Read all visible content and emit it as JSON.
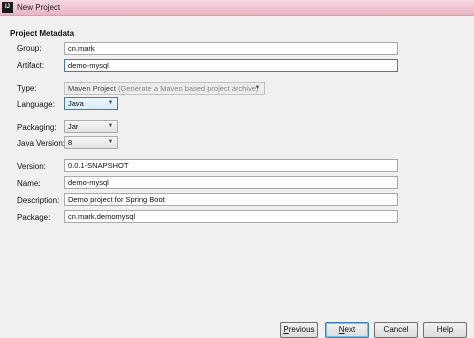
{
  "window": {
    "icon_text": "IJ",
    "title": "New Project"
  },
  "section_title": "Project Metadata",
  "fields": {
    "group": {
      "label": "Group:",
      "value": "cn.mark"
    },
    "artifact": {
      "label": "Artifact:",
      "value": "demo-mysql"
    },
    "type": {
      "label": "Type:",
      "value": "Maven Project",
      "hint": "(Generate a Maven based project archive)"
    },
    "language": {
      "label": "Language:",
      "value": "Java"
    },
    "packaging": {
      "label": "Packaging:",
      "value": "Jar"
    },
    "java_version": {
      "label": "Java Version:",
      "value": "8"
    },
    "version": {
      "label": "Version:",
      "value": "0.0.1-SNAPSHOT"
    },
    "name": {
      "label": "Name:",
      "value": "demo-mysql"
    },
    "description": {
      "label": "Description:",
      "value": "Demo project for Spring Boot"
    },
    "package": {
      "label": "Package:",
      "value": "cn.mark.demomysql"
    }
  },
  "buttons": {
    "previous_first": "P",
    "previous_rest": "revious",
    "next_first": "N",
    "next_rest": "ext",
    "cancel": "Cancel",
    "help": "Help"
  },
  "icons": {
    "dropdown": "chevron-down-icon"
  }
}
